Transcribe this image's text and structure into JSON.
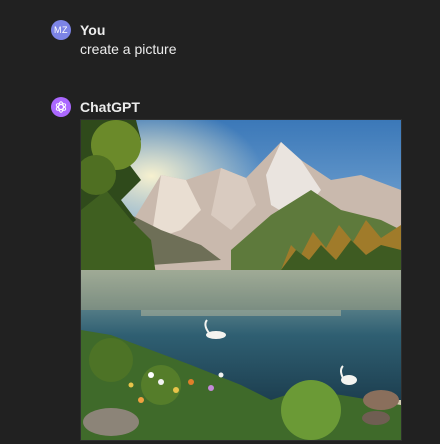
{
  "conversation": {
    "user_message": {
      "avatar_initials": "MZ",
      "author": "You",
      "text": "create a picture"
    },
    "assistant_message": {
      "author": "ChatGPT",
      "avatar_icon": "openai-logo-icon",
      "image_description_icon": "generated-image"
    }
  },
  "colors": {
    "background": "#212121",
    "user_avatar": "#7c84e6",
    "assistant_avatar": "#ab68ff",
    "text": "#ececec"
  }
}
